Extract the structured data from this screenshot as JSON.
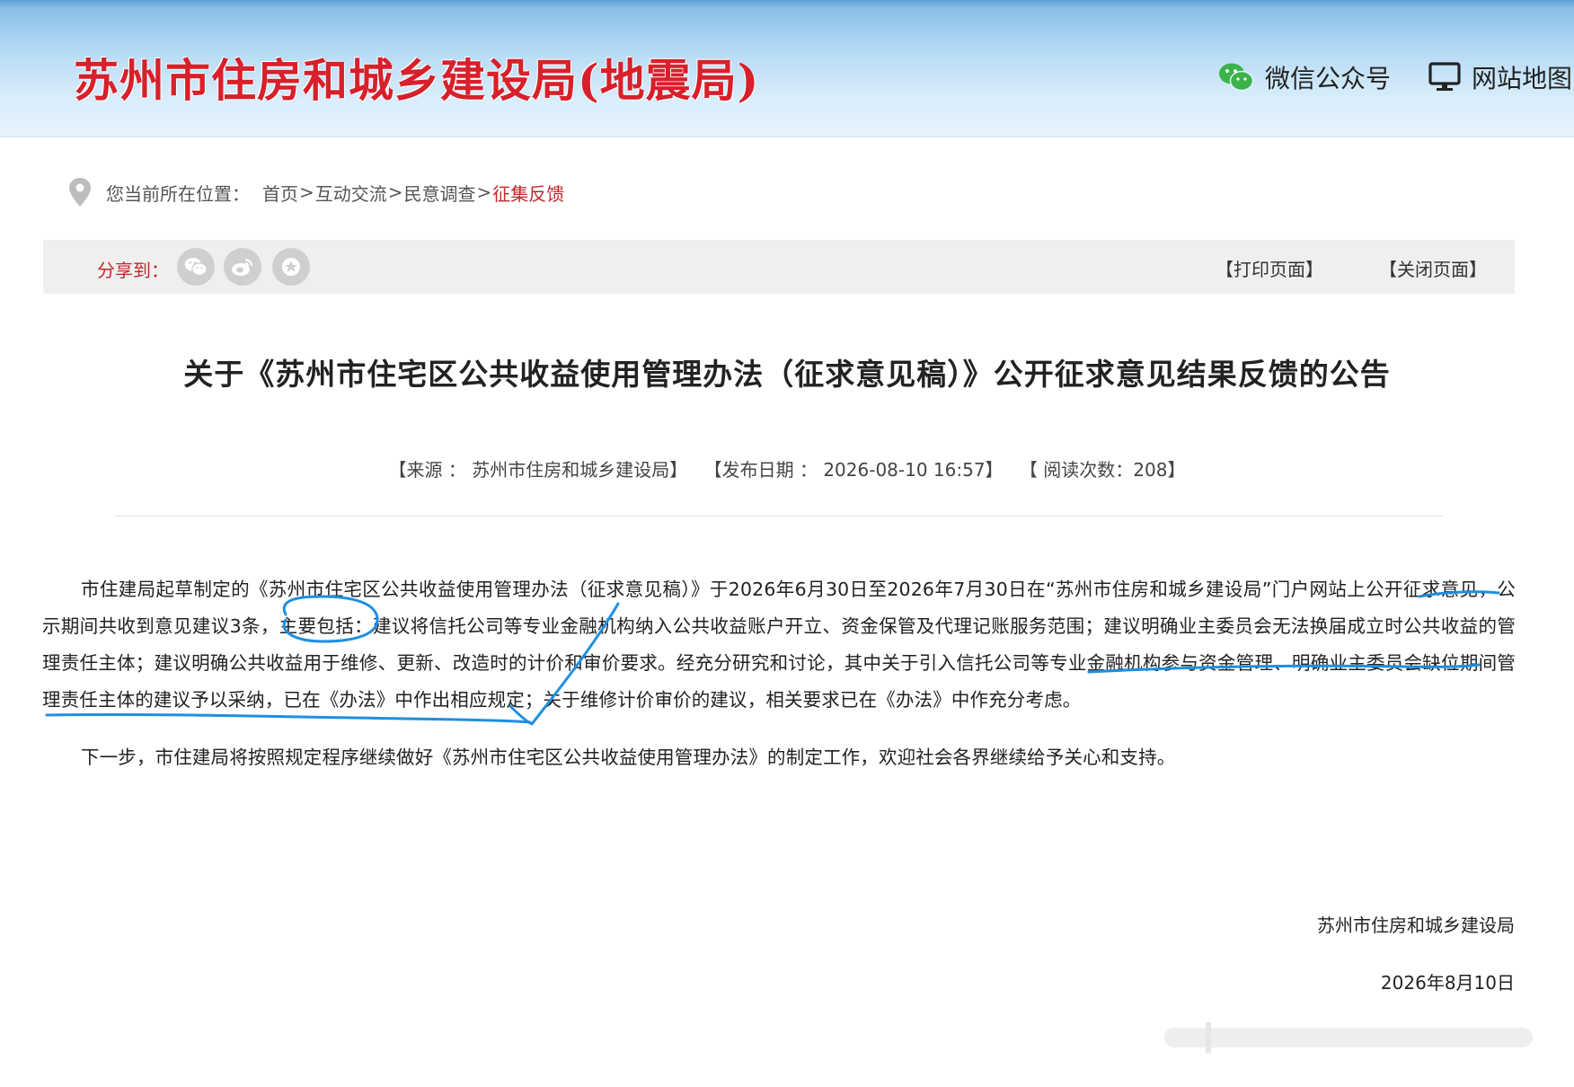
{
  "header": {
    "site_title": "苏州市住房和城乡建设局(地震局)",
    "wechat_label": "微信公众号",
    "sitemap_label": "网站地图",
    "icons": {
      "wechat": "wechat-icon",
      "sitemap": "monitor-icon"
    },
    "colors": {
      "title": "#d7202b",
      "wechat_green": "#3bb34a"
    }
  },
  "breadcrumb": {
    "prefix": "您当前所在位置：",
    "items": [
      "首页",
      "互动交流",
      "民意调查"
    ],
    "separator": ">",
    "current": "征集反馈",
    "current_color": "#c0282d"
  },
  "sharebar": {
    "label": "分享到：",
    "buttons": [
      "wechat-share-icon",
      "weibo-share-icon",
      "favorite-star-icon"
    ],
    "print_label": "【打印页面】",
    "close_label": "【关闭页面】"
  },
  "article": {
    "title": "关于《苏州市住宅区公共收益使用管理办法（征求意见稿）》公开征求意见结果反馈的公告",
    "meta": {
      "source": "【来源 ： 苏州市住房和城乡建设局】",
      "date": "【发布日期 ： 2026-08-10 16:57】",
      "reads": "【 阅读次数：208】"
    },
    "paragraphs": [
      "市住建局起草制定的《苏州市住宅区公共收益使用管理办法（征求意见稿）》于2026年6月30日至2026年7月30日在“苏州市住房和城乡建设局”门户网站上公开征求意见，公示期间共收到意见建议3条，主要包括：建议将信托公司等专业金融机构纳入公共收益账户开立、资金保管及代理记账服务范围；建议明确业主委员会无法换届成立时公共收益的管理责任主体；建议明确公共收益用于维修、更新、改造时的计价和审价要求。经充分研究和讨论，其中关于引入信托公司等专业金融机构参与资金管理、明确业主委员会缺位期间管理责任主体的建议予以采纳，已在《办法》中作出相应规定；关于维修计价审价的建议，相关要求已在《办法》中作充分考虑。",
      "下一步，市住建局将按照规定程序继续做好《苏州市住宅区公共收益使用管理办法》的制定工作，欢迎社会各界继续给予关心和支持。"
    ],
    "signature": "苏州市住房和城乡建设局",
    "sign_date": "2026年8月10日"
  },
  "annotation_color": "#1f8fe0"
}
